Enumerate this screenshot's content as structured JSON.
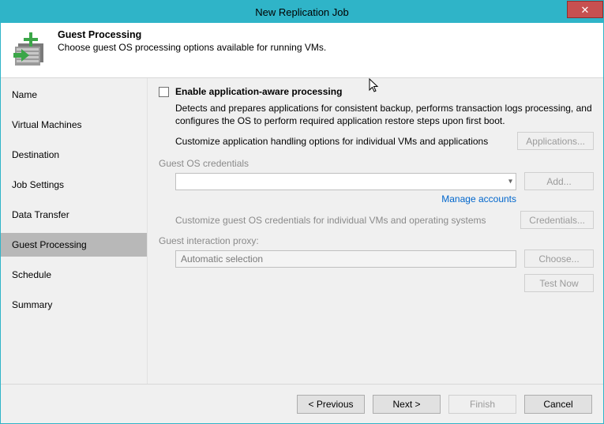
{
  "window": {
    "title": "New Replication Job"
  },
  "header": {
    "title": "Guest Processing",
    "subtitle": "Choose guest OS processing options available for running VMs."
  },
  "sidebar": {
    "items": [
      {
        "label": "Name"
      },
      {
        "label": "Virtual Machines"
      },
      {
        "label": "Destination"
      },
      {
        "label": "Job Settings"
      },
      {
        "label": "Data Transfer"
      },
      {
        "label": "Guest Processing",
        "active": true
      },
      {
        "label": "Schedule"
      },
      {
        "label": "Summary"
      }
    ]
  },
  "content": {
    "enable_label": "Enable application-aware processing",
    "enable_desc": "Detects and prepares applications for consistent backup, performs transaction logs processing, and configures the OS to perform required application restore steps upon first boot.",
    "customize_apps_label": "Customize application handling options for individual VMs and applications",
    "applications_btn": "Applications...",
    "guest_creds_group": "Guest OS credentials",
    "creds_value": "",
    "add_btn": "Add...",
    "manage_link": "Manage accounts",
    "customize_creds_label": "Customize guest OS credentials for individual VMs and operating systems",
    "credentials_btn": "Credentials...",
    "proxy_group": "Guest interaction proxy:",
    "proxy_value": "Automatic selection",
    "choose_btn": "Choose...",
    "test_btn": "Test Now"
  },
  "footer": {
    "previous": "< Previous",
    "next": "Next >",
    "finish": "Finish",
    "cancel": "Cancel"
  }
}
